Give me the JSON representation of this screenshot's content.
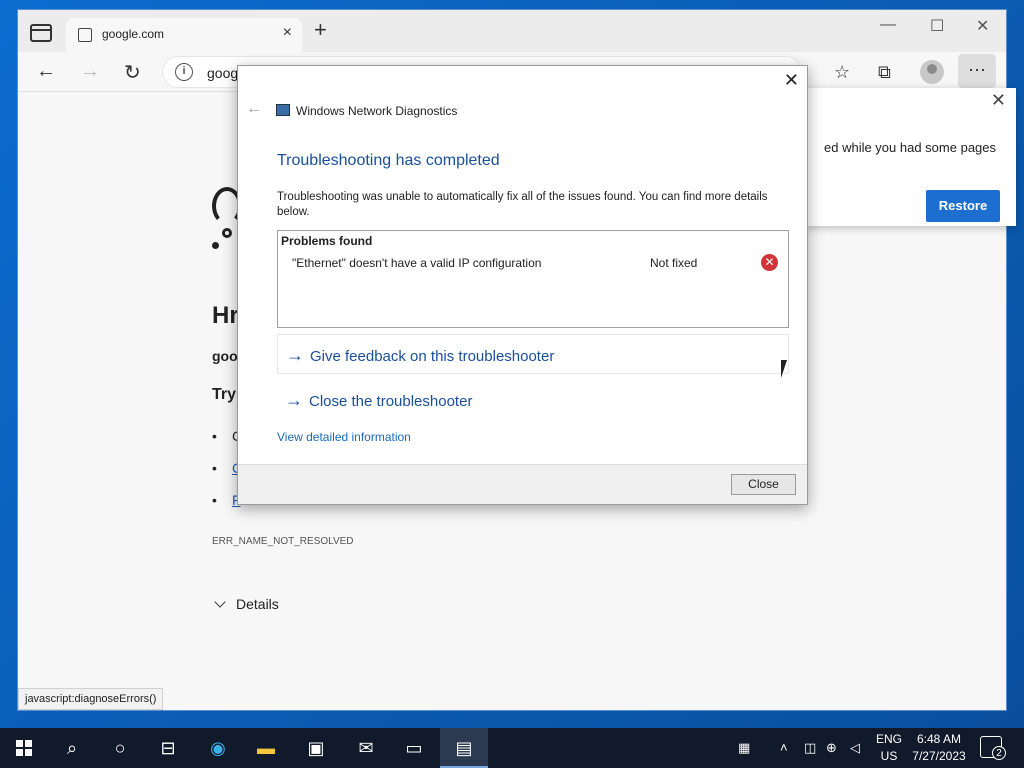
{
  "browser": {
    "tab_title": "google.com",
    "tab_close": "×",
    "new_tab": "+",
    "address_partial": "goog",
    "status_url": "javascript:diagnoseErrors()",
    "controls": {
      "minimize": "—",
      "maximize": "☐",
      "close": "✕"
    }
  },
  "error_page": {
    "heading": "Hr",
    "domain_partial": "goo",
    "try_label": "Try:",
    "bullets": [
      "C",
      "C",
      "F"
    ],
    "error_code": "ERR_NAME_NOT_RESOLVED",
    "details_label": "Details"
  },
  "restore_popup": {
    "text_partial": "ed while you had some pages",
    "restore_label": "Restore"
  },
  "dialog": {
    "app_title": "Windows Network Diagnostics",
    "heading": "Troubleshooting has completed",
    "description": "Troubleshooting was unable to automatically fix all of the issues found. You can find more details below.",
    "problems_header": "Problems found",
    "problems": [
      {
        "name": "\"Ethernet\" doesn't have a valid IP configuration",
        "status": "Not fixed",
        "icon": "error-icon"
      }
    ],
    "feedback_link": "Give feedback on this troubleshooter",
    "close_troubleshooter_link": "Close the troubleshooter",
    "detail_link": "View detailed information",
    "close_button": "Close"
  },
  "taskbar": {
    "lang_top": "ENG",
    "lang_bottom": "US",
    "time": "6:48 AM",
    "date": "7/27/2023",
    "notification_count": "2"
  }
}
